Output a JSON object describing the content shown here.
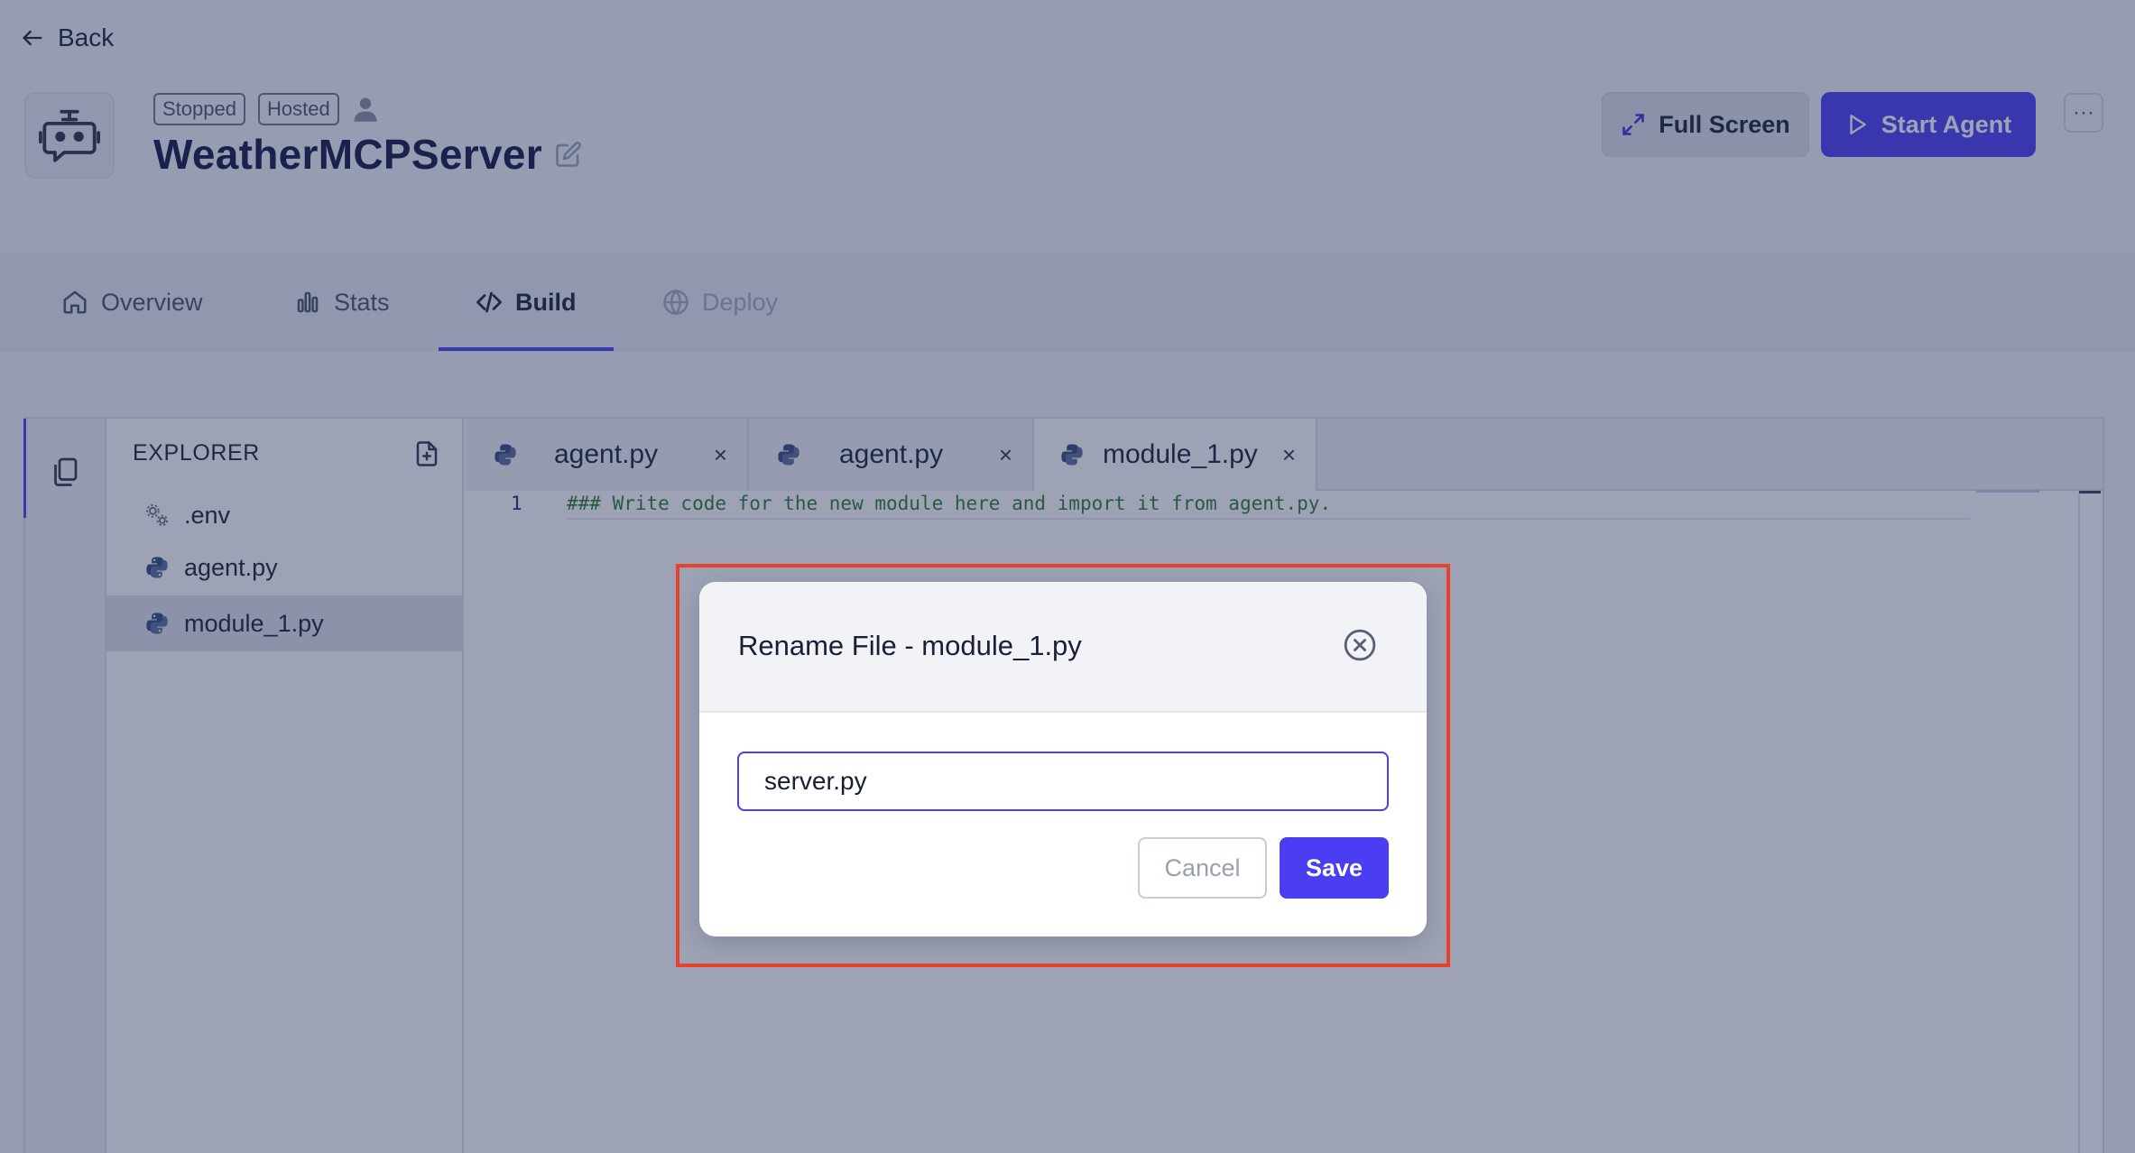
{
  "header": {
    "back_label": "Back",
    "status_badge": "Stopped",
    "hosted_badge": "Hosted",
    "agent_name": "WeatherMCPServer",
    "fullscreen_label": "Full Screen",
    "start_label": "Start Agent",
    "more_label": "···"
  },
  "nav": {
    "tabs": [
      {
        "label": "Overview"
      },
      {
        "label": "Stats"
      },
      {
        "label": "Build"
      },
      {
        "label": "Deploy"
      }
    ],
    "active_tab": "Build"
  },
  "explorer": {
    "title": "EXPLORER",
    "files": [
      {
        "name": ".env"
      },
      {
        "name": "agent.py"
      },
      {
        "name": "module_1.py"
      }
    ],
    "selected_file": "module_1.py"
  },
  "editor": {
    "tabs": [
      {
        "label": "agent.py",
        "close": "×"
      },
      {
        "label": "agent.py",
        "close": "×"
      },
      {
        "label": "module_1.py",
        "close": "×"
      }
    ],
    "lines": [
      {
        "number": "1",
        "text": "### Write code for the new module here and import it from agent.py."
      }
    ]
  },
  "modal": {
    "title": "Rename File - module_1.py",
    "input_value": "server.py",
    "cancel_label": "Cancel",
    "save_label": "Save"
  },
  "colors": {
    "accent": "#4a3df2",
    "highlight": "#e8412c",
    "overlay": "rgba(38,48,92,0.45)",
    "code_comment": "#2f7a2f"
  }
}
